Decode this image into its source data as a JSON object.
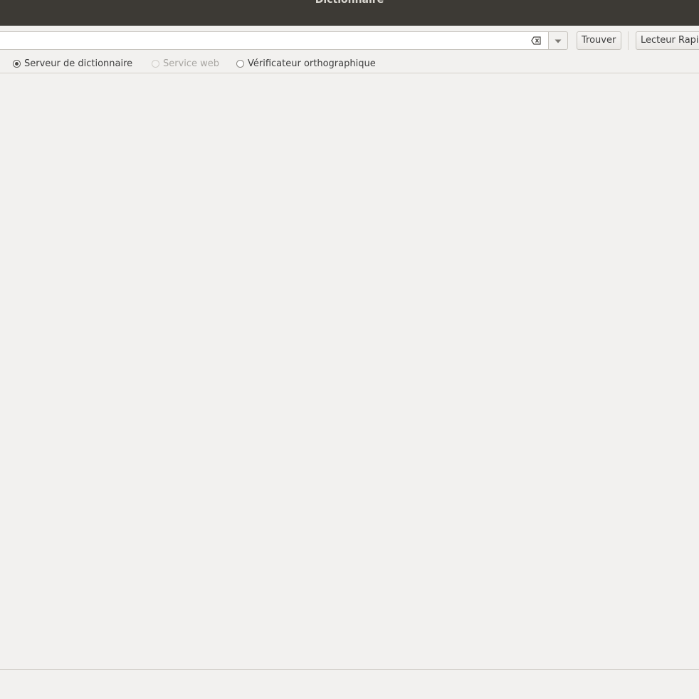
{
  "window": {
    "title": "Dictionnaire"
  },
  "toolbar": {
    "search_value": "",
    "find_label": "Trouver",
    "reader_label": "Lecteur Rapide",
    "clear_icon": "clear-text-icon",
    "dropdown_icon": "chevron-down-icon"
  },
  "sources": {
    "items": [
      {
        "label": "Serveur de dictionnaire",
        "checked": true,
        "enabled": true
      },
      {
        "label": "Service web",
        "checked": false,
        "enabled": false
      },
      {
        "label": "Vérificateur orthographique",
        "checked": false,
        "enabled": true
      }
    ]
  },
  "colors": {
    "titlebar": "#3d3a35",
    "background": "#f2f1ef",
    "border": "#c6c3bd"
  }
}
